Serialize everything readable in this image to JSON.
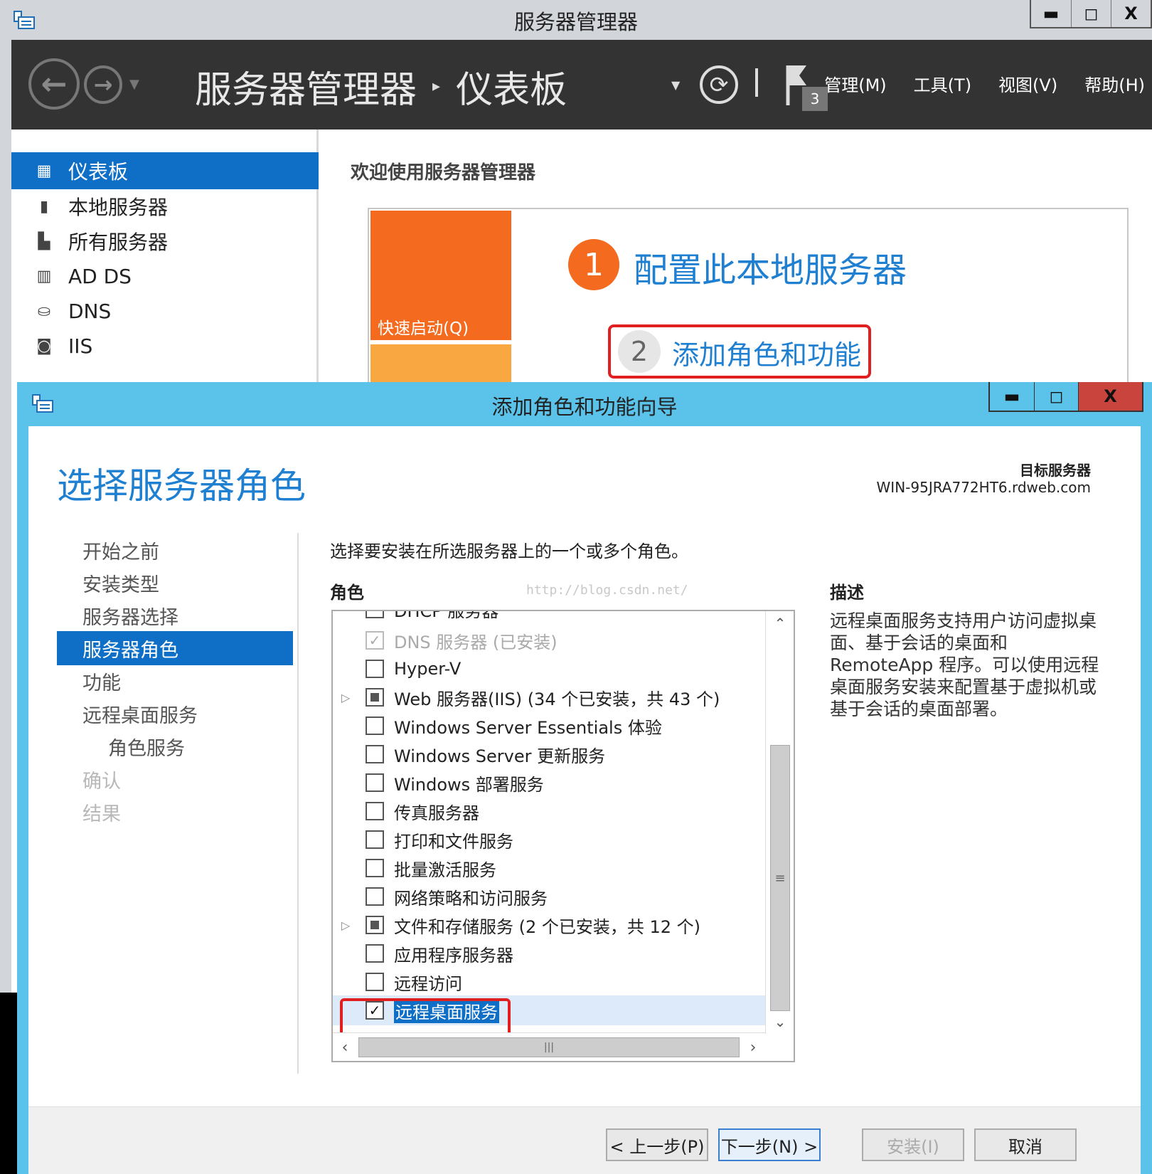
{
  "server_manager": {
    "window_title": "服务器管理器",
    "window_buttons": {
      "minimize": "▬",
      "maximize": "◻",
      "close": "X"
    },
    "breadcrumb": {
      "root": "服务器管理器",
      "separator": "▸",
      "current": "仪表板"
    },
    "notifications_count": "3",
    "menu": [
      "管理(M)",
      "工具(T)",
      "视图(V)",
      "帮助(H)"
    ],
    "sidebar": [
      {
        "label": "仪表板",
        "icon": "dashboard-icon",
        "active": true
      },
      {
        "label": "本地服务器",
        "icon": "server-icon",
        "active": false
      },
      {
        "label": "所有服务器",
        "icon": "servers-icon",
        "active": false
      },
      {
        "label": "AD DS",
        "icon": "ad-ds-icon",
        "active": false
      },
      {
        "label": "DNS",
        "icon": "dns-icon",
        "active": false
      },
      {
        "label": "IIS",
        "icon": "iis-icon",
        "active": false
      }
    ],
    "welcome_title": "欢迎使用服务器管理器",
    "quick_start_label": "快速启动(Q)",
    "step1": {
      "number": "1",
      "text": "配置此本地服务器"
    },
    "step2": {
      "number": "2",
      "text": "添加角色和功能"
    }
  },
  "wizard": {
    "window_title": "添加角色和功能向导",
    "window_buttons": {
      "minimize": "▬",
      "maximize": "◻",
      "close": "X"
    },
    "heading": "选择服务器角色",
    "target_label": "目标服务器",
    "target_value": "WIN-95JRA772HT6.rdweb.com",
    "nav": [
      {
        "label": "开始之前",
        "state": "normal"
      },
      {
        "label": "安装类型",
        "state": "normal"
      },
      {
        "label": "服务器选择",
        "state": "normal"
      },
      {
        "label": "服务器角色",
        "state": "active"
      },
      {
        "label": "功能",
        "state": "normal"
      },
      {
        "label": "远程桌面服务",
        "state": "normal"
      },
      {
        "label": "角色服务",
        "state": "sub"
      },
      {
        "label": "确认",
        "state": "dim"
      },
      {
        "label": "结果",
        "state": "dim"
      }
    ],
    "intro": "选择要安装在所选服务器上的一个或多个角色。",
    "roles_label": "角色",
    "description_label": "描述",
    "description": "远程桌面服务支持用户访问虚拟桌面、基于会话的桌面和 RemoteApp 程序。可以使用远程桌面服务安装来配置基于虚拟机或基于会话的桌面部署。",
    "watermark": "http://blog.csdn.net/",
    "roles": [
      {
        "label": "DHCP 服务器",
        "checked": "none",
        "disabled": false,
        "expandable": false
      },
      {
        "label": "DNS 服务器 (已安装)",
        "checked": "check",
        "disabled": true,
        "expandable": false
      },
      {
        "label": "Hyper-V",
        "checked": "none",
        "disabled": false,
        "expandable": false
      },
      {
        "label": "Web 服务器(IIS) (34 个已安装，共 43 个)",
        "checked": "partial",
        "disabled": false,
        "expandable": true
      },
      {
        "label": "Windows Server Essentials 体验",
        "checked": "none",
        "disabled": false,
        "expandable": false
      },
      {
        "label": "Windows Server 更新服务",
        "checked": "none",
        "disabled": false,
        "expandable": false
      },
      {
        "label": "Windows 部署服务",
        "checked": "none",
        "disabled": false,
        "expandable": false
      },
      {
        "label": "传真服务器",
        "checked": "none",
        "disabled": false,
        "expandable": false
      },
      {
        "label": "打印和文件服务",
        "checked": "none",
        "disabled": false,
        "expandable": false
      },
      {
        "label": "批量激活服务",
        "checked": "none",
        "disabled": false,
        "expandable": false
      },
      {
        "label": "网络策略和访问服务",
        "checked": "none",
        "disabled": false,
        "expandable": false
      },
      {
        "label": "文件和存储服务 (2 个已安装，共 12 个)",
        "checked": "partial",
        "disabled": false,
        "expandable": true
      },
      {
        "label": "应用程序服务器",
        "checked": "none",
        "disabled": false,
        "expandable": false
      },
      {
        "label": "远程访问",
        "checked": "none",
        "disabled": false,
        "expandable": false
      },
      {
        "label": "远程桌面服务",
        "checked": "check",
        "disabled": false,
        "expandable": false,
        "selected": true
      }
    ],
    "buttons": {
      "prev": "< 上一步(P)",
      "next": "下一步(N) >",
      "install": "安装(I)",
      "cancel": "取消"
    }
  }
}
